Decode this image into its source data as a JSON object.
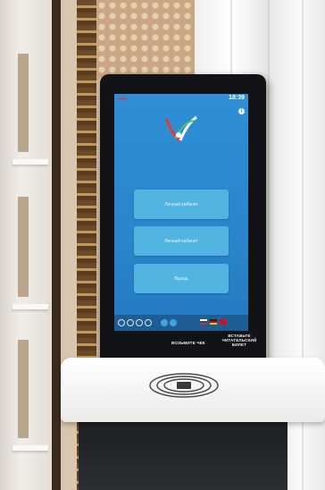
{
  "screen": {
    "clock": "18:39",
    "menu": [
      "Личный кабинет",
      "Личный кабинет",
      "Выход"
    ]
  },
  "kiosk_labels": {
    "receipt": "ВОЗЬМИТЕ ЧЕК",
    "card": "ВСТАВЬТЕ ЧИТАТЕЛЬСКИЙ БИЛЕТ"
  },
  "colors": {
    "screen_bg": "#2a86cc",
    "button": "#52b4e0",
    "kiosk_body": "#111316"
  }
}
